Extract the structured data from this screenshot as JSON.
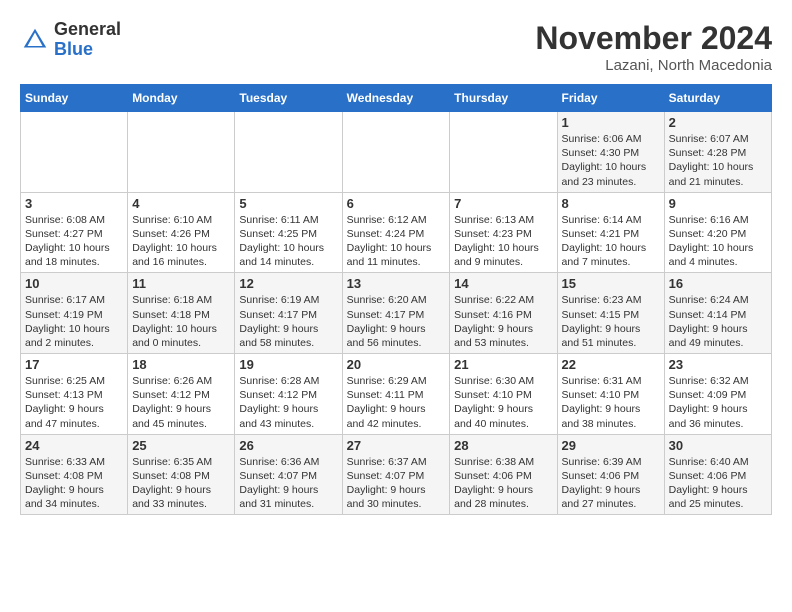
{
  "logo": {
    "general": "General",
    "blue": "Blue"
  },
  "title": "November 2024",
  "location": "Lazani, North Macedonia",
  "days_of_week": [
    "Sunday",
    "Monday",
    "Tuesday",
    "Wednesday",
    "Thursday",
    "Friday",
    "Saturday"
  ],
  "weeks": [
    [
      {
        "day": "",
        "info": ""
      },
      {
        "day": "",
        "info": ""
      },
      {
        "day": "",
        "info": ""
      },
      {
        "day": "",
        "info": ""
      },
      {
        "day": "",
        "info": ""
      },
      {
        "day": "1",
        "info": "Sunrise: 6:06 AM\nSunset: 4:30 PM\nDaylight: 10 hours\nand 23 minutes."
      },
      {
        "day": "2",
        "info": "Sunrise: 6:07 AM\nSunset: 4:28 PM\nDaylight: 10 hours\nand 21 minutes."
      }
    ],
    [
      {
        "day": "3",
        "info": "Sunrise: 6:08 AM\nSunset: 4:27 PM\nDaylight: 10 hours\nand 18 minutes."
      },
      {
        "day": "4",
        "info": "Sunrise: 6:10 AM\nSunset: 4:26 PM\nDaylight: 10 hours\nand 16 minutes."
      },
      {
        "day": "5",
        "info": "Sunrise: 6:11 AM\nSunset: 4:25 PM\nDaylight: 10 hours\nand 14 minutes."
      },
      {
        "day": "6",
        "info": "Sunrise: 6:12 AM\nSunset: 4:24 PM\nDaylight: 10 hours\nand 11 minutes."
      },
      {
        "day": "7",
        "info": "Sunrise: 6:13 AM\nSunset: 4:23 PM\nDaylight: 10 hours\nand 9 minutes."
      },
      {
        "day": "8",
        "info": "Sunrise: 6:14 AM\nSunset: 4:21 PM\nDaylight: 10 hours\nand 7 minutes."
      },
      {
        "day": "9",
        "info": "Sunrise: 6:16 AM\nSunset: 4:20 PM\nDaylight: 10 hours\nand 4 minutes."
      }
    ],
    [
      {
        "day": "10",
        "info": "Sunrise: 6:17 AM\nSunset: 4:19 PM\nDaylight: 10 hours\nand 2 minutes."
      },
      {
        "day": "11",
        "info": "Sunrise: 6:18 AM\nSunset: 4:18 PM\nDaylight: 10 hours\nand 0 minutes."
      },
      {
        "day": "12",
        "info": "Sunrise: 6:19 AM\nSunset: 4:17 PM\nDaylight: 9 hours\nand 58 minutes."
      },
      {
        "day": "13",
        "info": "Sunrise: 6:20 AM\nSunset: 4:17 PM\nDaylight: 9 hours\nand 56 minutes."
      },
      {
        "day": "14",
        "info": "Sunrise: 6:22 AM\nSunset: 4:16 PM\nDaylight: 9 hours\nand 53 minutes."
      },
      {
        "day": "15",
        "info": "Sunrise: 6:23 AM\nSunset: 4:15 PM\nDaylight: 9 hours\nand 51 minutes."
      },
      {
        "day": "16",
        "info": "Sunrise: 6:24 AM\nSunset: 4:14 PM\nDaylight: 9 hours\nand 49 minutes."
      }
    ],
    [
      {
        "day": "17",
        "info": "Sunrise: 6:25 AM\nSunset: 4:13 PM\nDaylight: 9 hours\nand 47 minutes."
      },
      {
        "day": "18",
        "info": "Sunrise: 6:26 AM\nSunset: 4:12 PM\nDaylight: 9 hours\nand 45 minutes."
      },
      {
        "day": "19",
        "info": "Sunrise: 6:28 AM\nSunset: 4:12 PM\nDaylight: 9 hours\nand 43 minutes."
      },
      {
        "day": "20",
        "info": "Sunrise: 6:29 AM\nSunset: 4:11 PM\nDaylight: 9 hours\nand 42 minutes."
      },
      {
        "day": "21",
        "info": "Sunrise: 6:30 AM\nSunset: 4:10 PM\nDaylight: 9 hours\nand 40 minutes."
      },
      {
        "day": "22",
        "info": "Sunrise: 6:31 AM\nSunset: 4:10 PM\nDaylight: 9 hours\nand 38 minutes."
      },
      {
        "day": "23",
        "info": "Sunrise: 6:32 AM\nSunset: 4:09 PM\nDaylight: 9 hours\nand 36 minutes."
      }
    ],
    [
      {
        "day": "24",
        "info": "Sunrise: 6:33 AM\nSunset: 4:08 PM\nDaylight: 9 hours\nand 34 minutes."
      },
      {
        "day": "25",
        "info": "Sunrise: 6:35 AM\nSunset: 4:08 PM\nDaylight: 9 hours\nand 33 minutes."
      },
      {
        "day": "26",
        "info": "Sunrise: 6:36 AM\nSunset: 4:07 PM\nDaylight: 9 hours\nand 31 minutes."
      },
      {
        "day": "27",
        "info": "Sunrise: 6:37 AM\nSunset: 4:07 PM\nDaylight: 9 hours\nand 30 minutes."
      },
      {
        "day": "28",
        "info": "Sunrise: 6:38 AM\nSunset: 4:06 PM\nDaylight: 9 hours\nand 28 minutes."
      },
      {
        "day": "29",
        "info": "Sunrise: 6:39 AM\nSunset: 4:06 PM\nDaylight: 9 hours\nand 27 minutes."
      },
      {
        "day": "30",
        "info": "Sunrise: 6:40 AM\nSunset: 4:06 PM\nDaylight: 9 hours\nand 25 minutes."
      }
    ]
  ]
}
